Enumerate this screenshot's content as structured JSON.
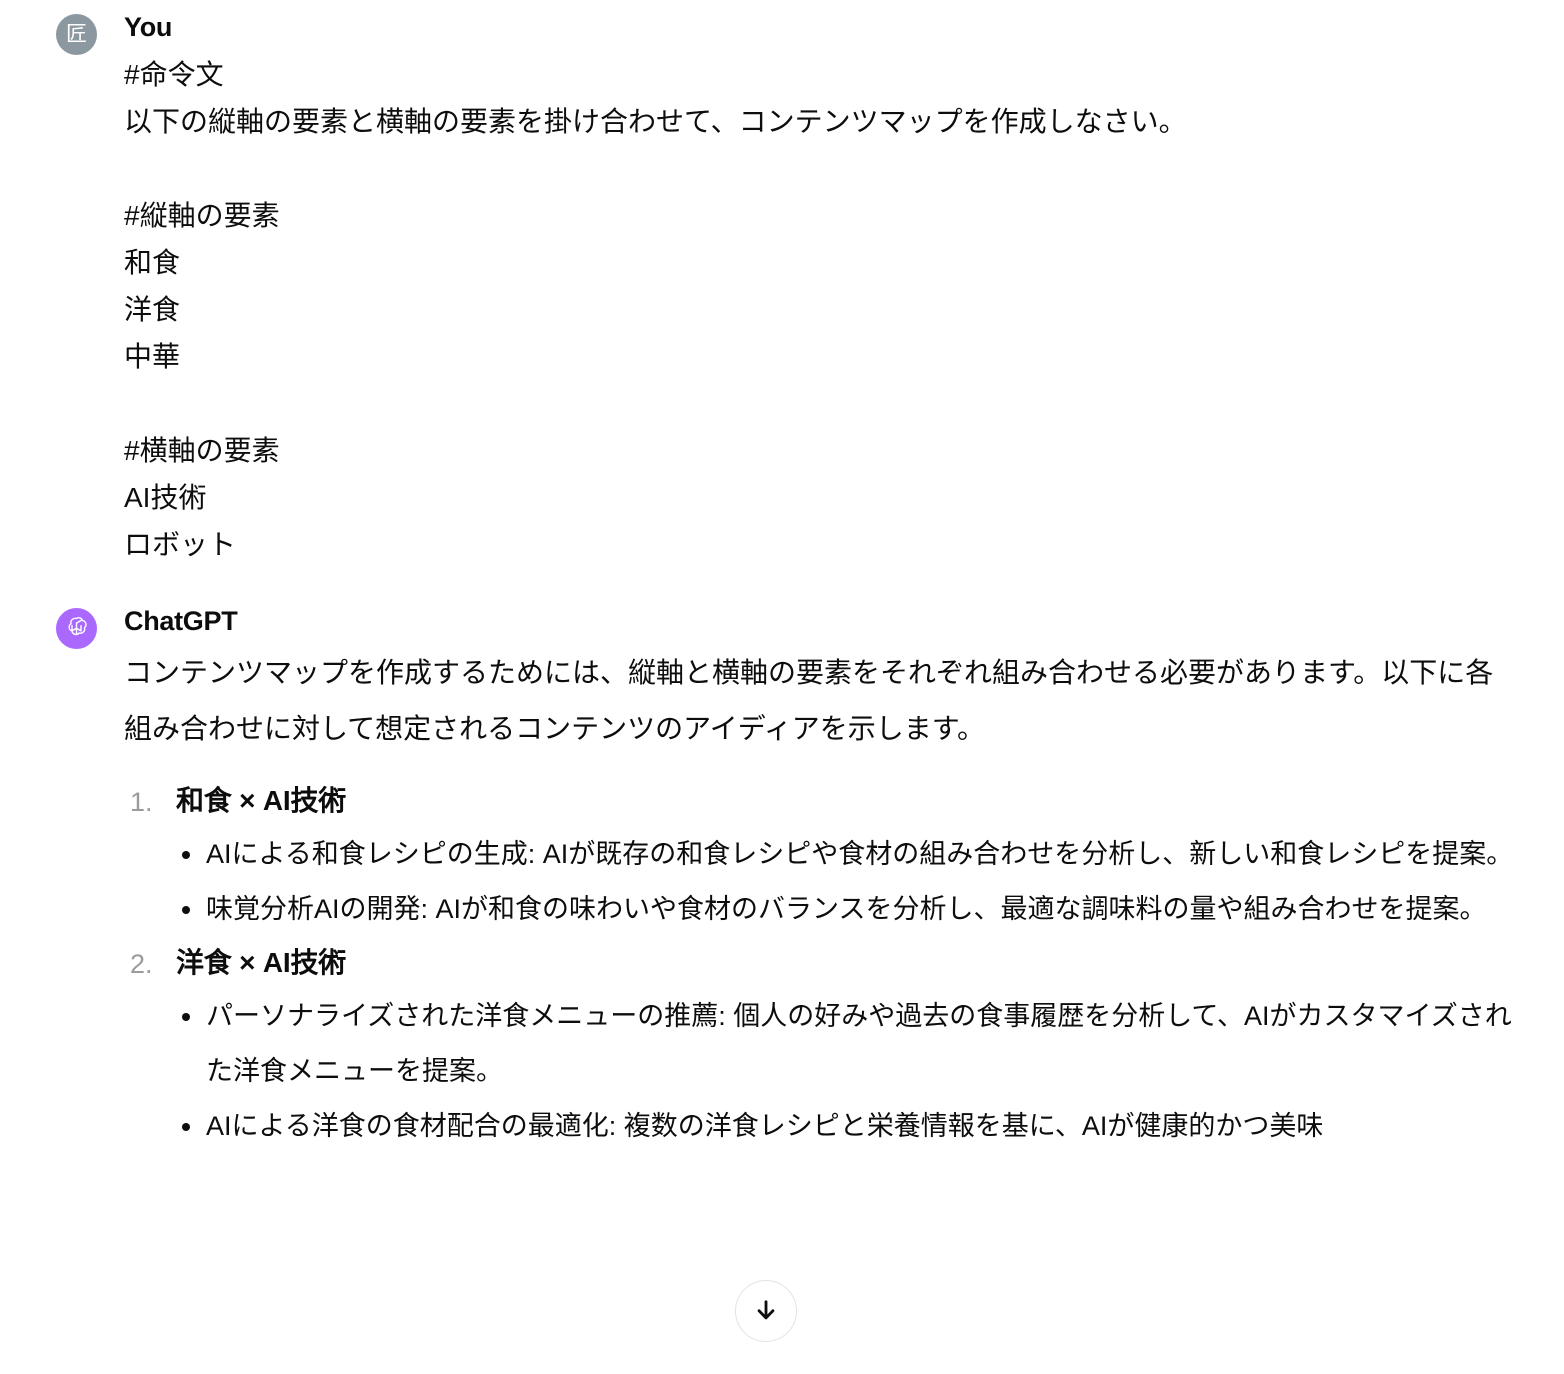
{
  "conversation": {
    "messages": [
      {
        "role": "user",
        "author": "You",
        "avatar_icon": "user-avatar-kanji",
        "avatar_glyph": "匠",
        "avatar_color": "#8c98a0",
        "text": "#命令文\n以下の縦軸の要素と横軸の要素を掛け合わせて、コンテンツマップを作成しなさい。\n\n#縦軸の要素\n和食\n洋食\n中華\n\n#横軸の要素\nAI技術\nロボット"
      },
      {
        "role": "assistant",
        "author": "ChatGPT",
        "avatar_icon": "openai-logo-icon",
        "avatar_color": "#ab68ff",
        "intro": "コンテンツマップを作成するためには、縦軸と横軸の要素をそれぞれ組み合わせる必要があります。以下に各組み合わせに対して想定されるコンテンツのアイディアを示します。",
        "items": [
          {
            "number": "1.",
            "title": "和食 × AI技術",
            "bullets": [
              "AIによる和食レシピの生成: AIが既存の和食レシピや食材の組み合わせを分析し、新しい和食レシピを提案。",
              "味覚分析AIの開発: AIが和食の味わいや食材のバランスを分析し、最適な調味料の量や組み合わせを提案。"
            ]
          },
          {
            "number": "2.",
            "title": "洋食 × AI技術",
            "bullets": [
              "パーソナライズされた洋食メニューの推薦: 個人の好みや過去の食事履歴を分析して、AIがカスタマイズされた洋食メニューを提案。",
              "AIによる洋食の食材配合の最適化: 複数の洋食レシピと栄養情報を基に、AIが健康的かつ美味"
            ]
          }
        ]
      }
    ]
  },
  "scroll_button": {
    "icon": "arrow-down-icon",
    "label": "↓"
  }
}
